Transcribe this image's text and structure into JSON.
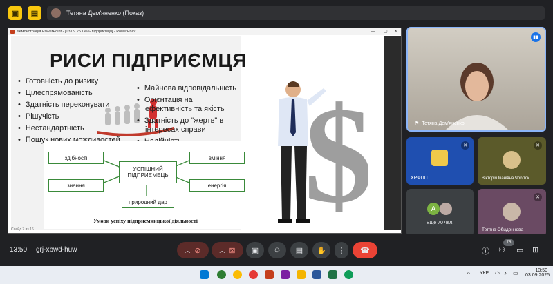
{
  "meeting": {
    "presenter_label": "Тетяна Дем'яненко (Показ)",
    "time": "13:50",
    "code": "grj-xbwd-huw",
    "participants_badge": "75"
  },
  "ppt": {
    "window_title": "Демонстрація PowerPoint - [03.09.25 День підприємця] - PowerPoint",
    "status": "Слайд 7 из 16",
    "heading": "РИСИ ПІДПРИЄМЦЯ",
    "left_bullets": [
      "Готовність до ризику",
      "Цілеспрямованість",
      "Здатність переконувати",
      "Рішучість",
      "Нестандартність",
      "Пошук нових можливостей"
    ],
    "right_bullets": [
      "Майнова відповідальність",
      "Орієнтація на ефективність та якість",
      "Здатність до \"жертв\" в інтересах справи",
      "Надійність"
    ],
    "diagram": {
      "center": "УСПІШНИЙ ПІДПРИЄМЕЦЬ",
      "top_left": "здібності",
      "bottom_left": "знання",
      "top_right": "вміння",
      "bottom_right": "енергія",
      "bottom": "природний дар",
      "caption": "Умови успіху підприємницької діяльності"
    }
  },
  "tiles": {
    "main_speaker": "Тетяна Дем'яненко",
    "t1": "ХРФПП",
    "t2": "Вікторія Іванівна Чобіток",
    "t3_initial": "A",
    "t3": "Ещё 70 чел.",
    "t4": "Тетяна Обиденнова"
  },
  "taskbar": {
    "lang": "УКР",
    "time": "13:50",
    "date": "03.09.2025"
  },
  "colors": {
    "accent_yellow": "#f9c80e",
    "control_red": "#ea4335",
    "tile_blue": "#1f4fb0",
    "tile_olive": "#5b5a2a",
    "tile_mauve": "#6a4a63"
  }
}
